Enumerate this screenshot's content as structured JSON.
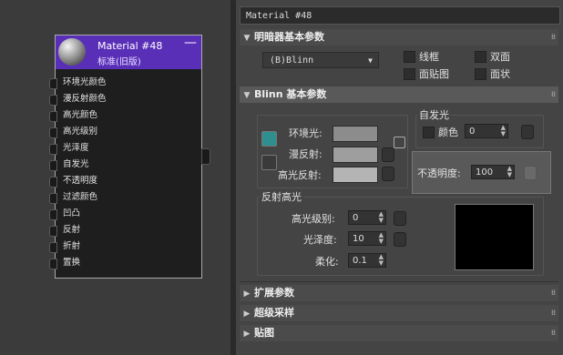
{
  "node": {
    "title": "Material #48",
    "subtitle": "标准(旧版)",
    "minimize": "—",
    "slots": [
      "环境光颜色",
      "漫反射颜色",
      "高光颜色",
      "高光级别",
      "光泽度",
      "自发光",
      "不透明度",
      "过滤颜色",
      "凹凸",
      "反射",
      "折射",
      "置换"
    ]
  },
  "panel": {
    "material_name": "Material #48",
    "rollouts": {
      "shader": {
        "label": "明暗器基本参数",
        "arrow": "▼"
      },
      "blinn": {
        "label": "Blinn 基本参数",
        "arrow": "▼"
      },
      "extended": {
        "label": "扩展参数",
        "arrow": "▶"
      },
      "supersample": {
        "label": "超级采样",
        "arrow": "▶"
      },
      "maps": {
        "label": "贴图",
        "arrow": "▶"
      }
    },
    "grip": "⁞⁞",
    "shader": {
      "selected": "(B)Blinn",
      "dropdown_icon": "▼",
      "options": {
        "wire": "线框",
        "two_sided": "双面",
        "face_map": "面贴图",
        "faceted": "面状"
      }
    },
    "blinn": {
      "ambient_label": "环境光:",
      "diffuse_label": "漫反射:",
      "specular_label": "高光反射:",
      "self_illum_group": "自发光",
      "color_label": "颜色",
      "self_illum_value": "0",
      "opacity_label": "不透明度:",
      "opacity_value": "100",
      "spec_group": "反射高光",
      "spec_level_label": "高光级别:",
      "spec_level_value": "0",
      "gloss_label": "光泽度:",
      "gloss_value": "10",
      "soften_label": "柔化:",
      "soften_value": "0.1",
      "swatch_colors": {
        "ambient": "#8c8c8c",
        "diffuse": "#9e9e9e",
        "specular": "#b4b4b4"
      }
    },
    "spin_arrows": "▲▼"
  }
}
